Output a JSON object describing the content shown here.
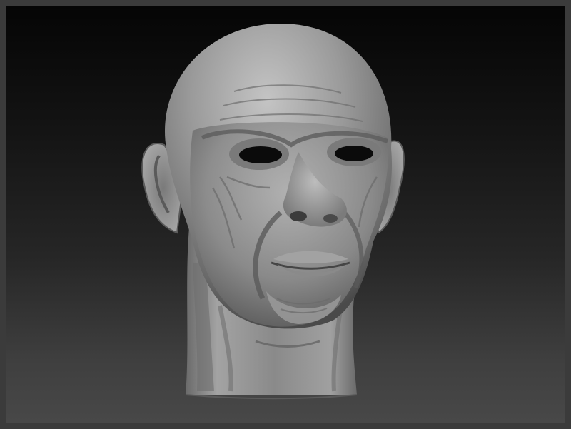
{
  "scene": {
    "subject": "sculpted-head-model",
    "colors": {
      "frame": "#3b3b3b",
      "background_top": "#050505",
      "background_bottom": "#484848",
      "clay_light": "#b9b9b9",
      "clay_mid": "#8e8e8e",
      "clay_dark": "#4a4a4a",
      "eye_socket": "#0b0b0b"
    }
  }
}
